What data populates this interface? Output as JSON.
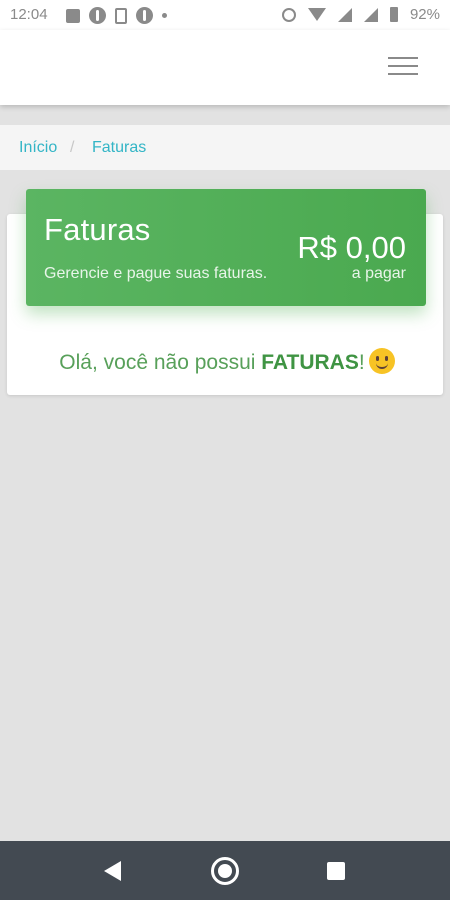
{
  "status_bar": {
    "time": "12:04",
    "battery": "92%",
    "icons": [
      "news-icon",
      "info-icon",
      "phone-icon",
      "info-icon",
      "dot-icon",
      "alarm-icon",
      "wifi-icon",
      "signal-icon",
      "signal-icon",
      "battery-icon"
    ]
  },
  "app_bar": {
    "menu_icon": "hamburger-menu-icon"
  },
  "breadcrumb": {
    "items": [
      {
        "label": "Início"
      },
      {
        "label": "Faturas"
      }
    ],
    "separator": "/"
  },
  "banner": {
    "title": "Faturas",
    "subtitle": "Gerencie e pague suas faturas.",
    "amount": "R$ 0,00",
    "amount_caption": "a pagar"
  },
  "empty_state": {
    "message_prefix": "Olá, você não possui ",
    "message_bold": "FATURAS",
    "message_suffix": "!",
    "emoji": "smiley-icon"
  },
  "nav_bar": {
    "buttons": [
      "back-icon",
      "home-icon",
      "recents-icon"
    ]
  },
  "colors": {
    "accent_green": "#4caf50",
    "link_teal": "#33b5c6",
    "background": "#e2e2e2",
    "nav_bar": "#434a52"
  }
}
